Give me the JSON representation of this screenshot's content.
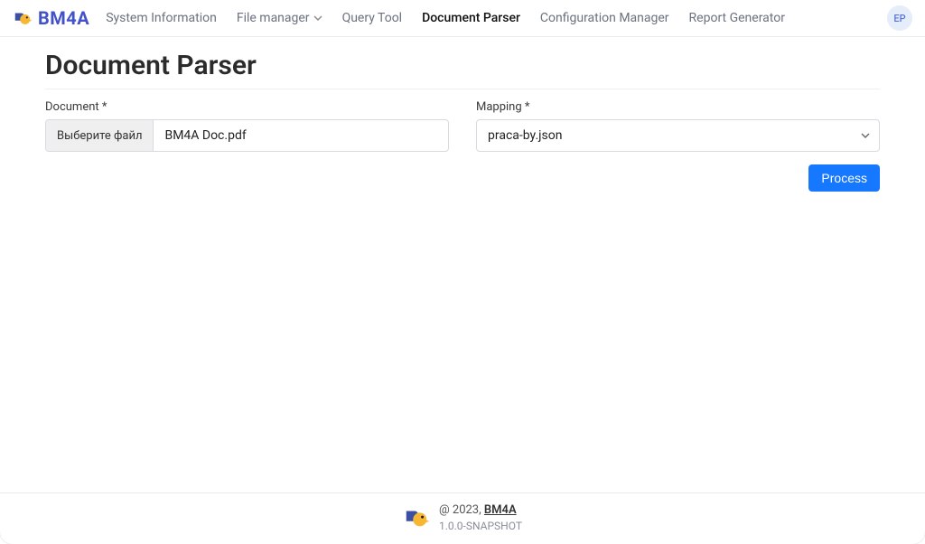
{
  "brand": {
    "name": "BM4A"
  },
  "nav": {
    "items": [
      {
        "label": "System Information",
        "active": false,
        "dropdown": false
      },
      {
        "label": "File manager",
        "active": false,
        "dropdown": true
      },
      {
        "label": "Query Tool",
        "active": false,
        "dropdown": false
      },
      {
        "label": "Document Parser",
        "active": true,
        "dropdown": false
      },
      {
        "label": "Configuration Manager",
        "active": false,
        "dropdown": false
      },
      {
        "label": "Report Generator",
        "active": false,
        "dropdown": false
      }
    ]
  },
  "user": {
    "initials": "EP"
  },
  "page": {
    "title": "Document Parser"
  },
  "form": {
    "document": {
      "label": "Document *",
      "choose_btn": "Выберите файл",
      "file_name": "BM4A Doc.pdf"
    },
    "mapping": {
      "label": "Mapping *",
      "selected": "praca-by.json"
    },
    "process_btn": "Process"
  },
  "footer": {
    "copyright_prefix": "@ 2023, ",
    "brand_link": "BM4A",
    "version": "1.0.0-SNAPSHOT"
  }
}
